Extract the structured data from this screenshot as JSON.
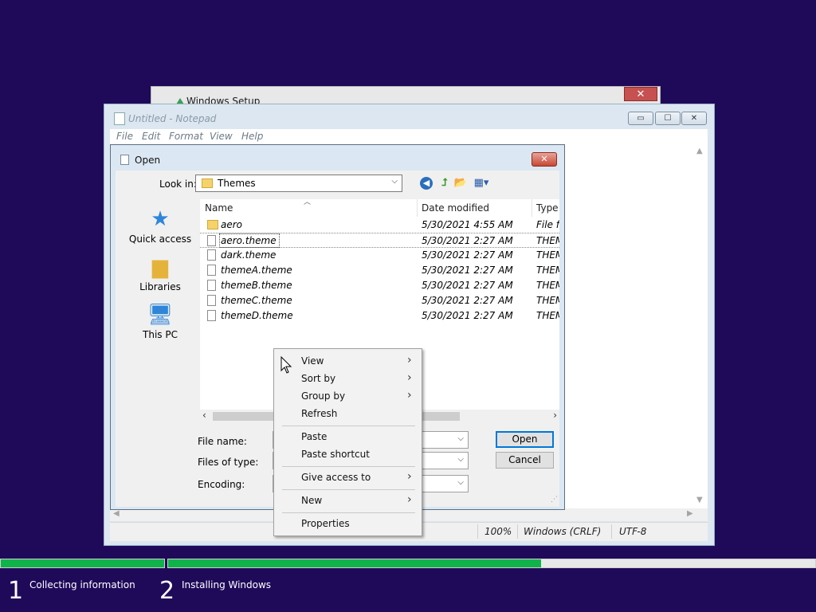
{
  "setup_window": {
    "title": "Windows Setup",
    "close_glyph": "✕"
  },
  "notepad": {
    "title": "Untitled - Notepad",
    "menu": [
      "File",
      "Edit",
      "Format",
      "View",
      "Help"
    ],
    "buttons": {
      "minimize": "▭",
      "maximize": "☐",
      "close": "✕"
    },
    "status": {
      "zoom": "100%",
      "line_ending": "Windows (CRLF)",
      "encoding": "UTF-8"
    }
  },
  "open_dialog": {
    "title": "Open",
    "look_in_label": "Look in:",
    "look_in_value": "Themes",
    "places": [
      {
        "label": "Quick access",
        "icon": "star-icon"
      },
      {
        "label": "Libraries",
        "icon": "libraries-icon"
      },
      {
        "label": "This PC",
        "icon": "computer-icon"
      }
    ],
    "columns": {
      "name": "Name",
      "date": "Date modified",
      "type": "Type"
    },
    "files": [
      {
        "name": "aero",
        "date": "5/30/2021 4:55 AM",
        "type": "File fo",
        "kind": "folder"
      },
      {
        "name": "aero.theme",
        "date": "5/30/2021 2:27 AM",
        "type": "THEM",
        "kind": "file"
      },
      {
        "name": "dark.theme",
        "date": "5/30/2021 2:27 AM",
        "type": "THEM",
        "kind": "file"
      },
      {
        "name": "themeA.theme",
        "date": "5/30/2021 2:27 AM",
        "type": "THEM",
        "kind": "file"
      },
      {
        "name": "themeB.theme",
        "date": "5/30/2021 2:27 AM",
        "type": "THEM",
        "kind": "file"
      },
      {
        "name": "themeC.theme",
        "date": "5/30/2021 2:27 AM",
        "type": "THEM",
        "kind": "file"
      },
      {
        "name": "themeD.theme",
        "date": "5/30/2021 2:27 AM",
        "type": "THEM",
        "kind": "file"
      }
    ],
    "file_name_label": "File name:",
    "files_of_type_label": "Files of type:",
    "encoding_label": "Encoding:",
    "open_button": "Open",
    "cancel_button": "Cancel"
  },
  "context_menu": {
    "items": [
      {
        "label": "View",
        "submenu": true
      },
      {
        "label": "Sort by",
        "submenu": true
      },
      {
        "label": "Group by",
        "submenu": true
      },
      {
        "label": "Refresh",
        "submenu": false
      },
      {
        "label": "Paste",
        "submenu": false
      },
      {
        "label": "Paste shortcut",
        "submenu": false
      },
      {
        "label": "Give access to",
        "submenu": true
      },
      {
        "label": "New",
        "submenu": true
      },
      {
        "label": "Properties",
        "submenu": false
      }
    ]
  },
  "setup_progress": {
    "steps": [
      {
        "number": "1",
        "label": "Collecting information"
      },
      {
        "number": "2",
        "label": "Installing Windows"
      }
    ],
    "step2_progress": 0.576,
    "accent_color": "#0fb34a",
    "background_color": "#1f0a5a"
  }
}
